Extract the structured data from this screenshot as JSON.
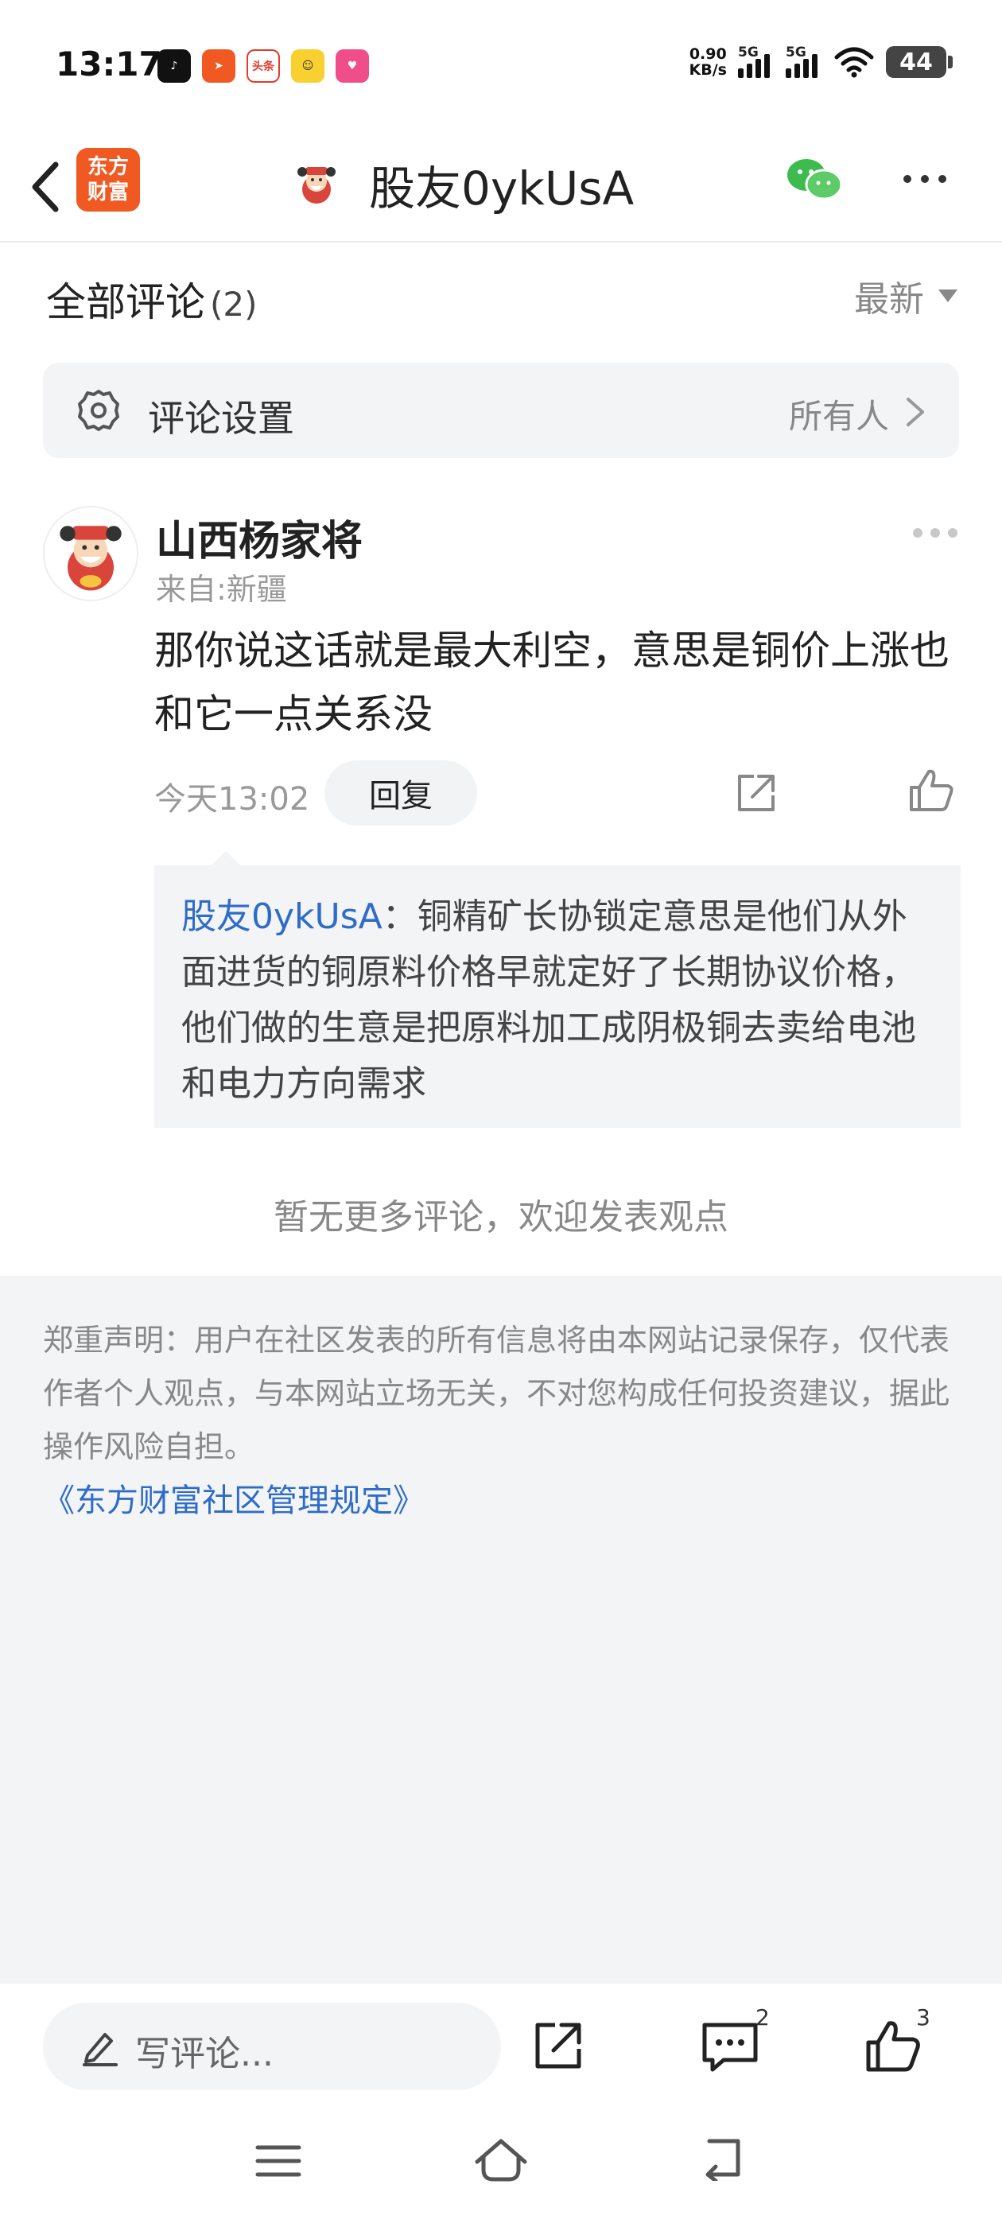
{
  "status_bar": {
    "time": "13:17",
    "net_speed_value": "0.90",
    "net_speed_unit": "KB/s",
    "sim1": "5G",
    "sim2": "5G",
    "battery": "44",
    "app_icons": [
      {
        "icon": "douyin-icon",
        "color": "#111111",
        "label": ""
      },
      {
        "icon": "app-orange-icon",
        "color": "#f05a22",
        "label": ""
      },
      {
        "icon": "toutiao-icon",
        "color": "#e33b2e",
        "label": "头条"
      },
      {
        "icon": "app-yellow-icon",
        "color": "#f8d130",
        "label": ""
      },
      {
        "icon": "app-pink-icon",
        "color": "#ef4e8a",
        "label": ""
      }
    ]
  },
  "header": {
    "logo_text": "东方\n财富",
    "title": "股友0ykUsA",
    "brand_color": "#f05a22"
  },
  "comments_section": {
    "title": "全部评论",
    "count": "(2)",
    "sort_label": "最新",
    "settings_label": "评论设置",
    "settings_value": "所有人"
  },
  "comment": {
    "author": "山西杨家将",
    "location": "来自:新疆",
    "text": "那你说这话就是最大利空，意思是铜价上涨也和它一点关系没",
    "time": "今天13:02",
    "reply_label": "回复",
    "quote_user": "股友0ykUsA",
    "quote_text": "：铜精矿长协锁定意思是他们从外面进货的铜原料价格早就定好了长期协议价格，他们做的生意是把原料加工成阴极铜去卖给电池和电力方向需求"
  },
  "no_more_text": "暂无更多评论，欢迎发表观点",
  "disclaimer": {
    "text": "郑重声明：用户在社区发表的所有信息将由本网站记录保存，仅代表作者个人观点，与本网站立场无关，不对您构成任何投资建议，据此操作风险自担。",
    "link": "《东方财富社区管理规定》",
    "link_color": "#2f6cc8"
  },
  "bottom_bar": {
    "write_placeholder": "写评论...",
    "comment_count": "2",
    "like_count": "3"
  }
}
